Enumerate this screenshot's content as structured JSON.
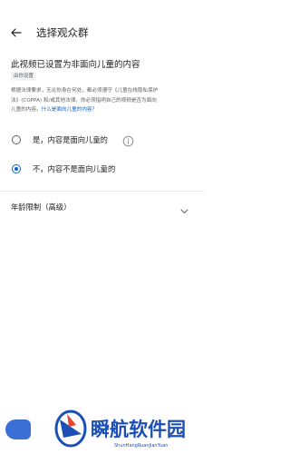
{
  "header": {
    "title": "选择观众群"
  },
  "notice": {
    "title": "此视频已设置为非面向儿童的内容",
    "badge": "由你设置",
    "desc_line1": "根据法律要求，无论你身在何处，都必须遵守《儿童在线隐私保护",
    "desc_line2": "法》(COPPA) 和/或其他法律。你必须指明自己的视频是否为面向",
    "desc_line3_prefix": "儿童的内容。",
    "desc_link": "什么是面向儿童的内容？"
  },
  "audience": {
    "options": [
      {
        "label": "是，内容是面向儿童的",
        "selected": false
      },
      {
        "label": "不，内容不是面向儿童的",
        "selected": true
      }
    ]
  },
  "age_restriction": {
    "label": "年龄限制（高级）"
  },
  "watermark": {
    "text": "瞬航软件园",
    "sub": "ShunHangRuanJianYuan"
  },
  "colors": {
    "accent": "#065fd4",
    "watermark_blue": "#1b4fb5"
  }
}
